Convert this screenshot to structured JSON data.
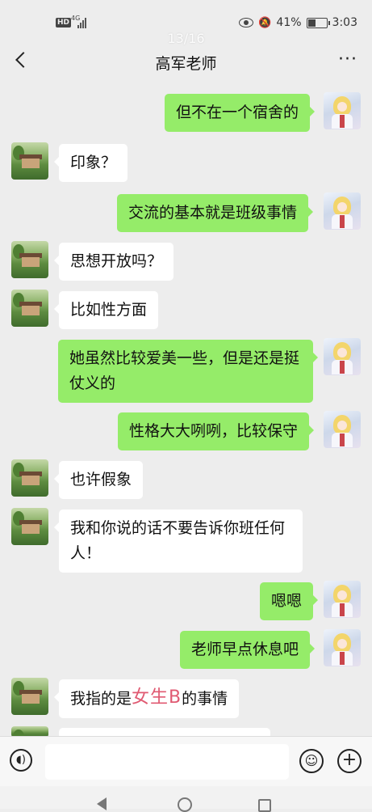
{
  "status_bar": {
    "hd": "HD",
    "network": "4G",
    "battery_percent": "41%",
    "time": "3:03"
  },
  "page_indicator": "13/16",
  "header": {
    "title": "高军老师",
    "more": "···"
  },
  "messages": [
    {
      "sender": "student",
      "text": "但不在一个宿舍的"
    },
    {
      "sender": "teacher",
      "text": "印象？"
    },
    {
      "sender": "student",
      "text": "交流的基本就是班级事情"
    },
    {
      "sender": "teacher",
      "text": "思想开放吗？"
    },
    {
      "sender": "teacher",
      "text": "比如性方面"
    },
    {
      "sender": "student",
      "line1": "她虽然比较爱美一些，但是还是挺",
      "line2": "仗义的"
    },
    {
      "sender": "student",
      "text": "性格大大咧咧，比较保守"
    },
    {
      "sender": "teacher",
      "text": "也许假象"
    },
    {
      "sender": "teacher",
      "line1": "我和你说的话不要告诉你班任何",
      "line2": "人！"
    },
    {
      "sender": "student",
      "text": "嗯嗯"
    },
    {
      "sender": "student",
      "text": "老师早点休息吧"
    },
    {
      "sender": "teacher",
      "prefix": "我指的是",
      "overlay": "女生B",
      "suffix": "的事情"
    }
  ],
  "input_bar": {
    "placeholder": ""
  },
  "colors": {
    "background": "#ededed",
    "sent_bubble": "#95ec69",
    "received_bubble": "#ffffff",
    "overlay_text": "#e05a72"
  },
  "icons": {
    "back": "chevron-left-icon",
    "more": "more-dots-icon",
    "voice": "voice-icon",
    "emoji": "emoji-icon",
    "plus": "plus-icon"
  }
}
